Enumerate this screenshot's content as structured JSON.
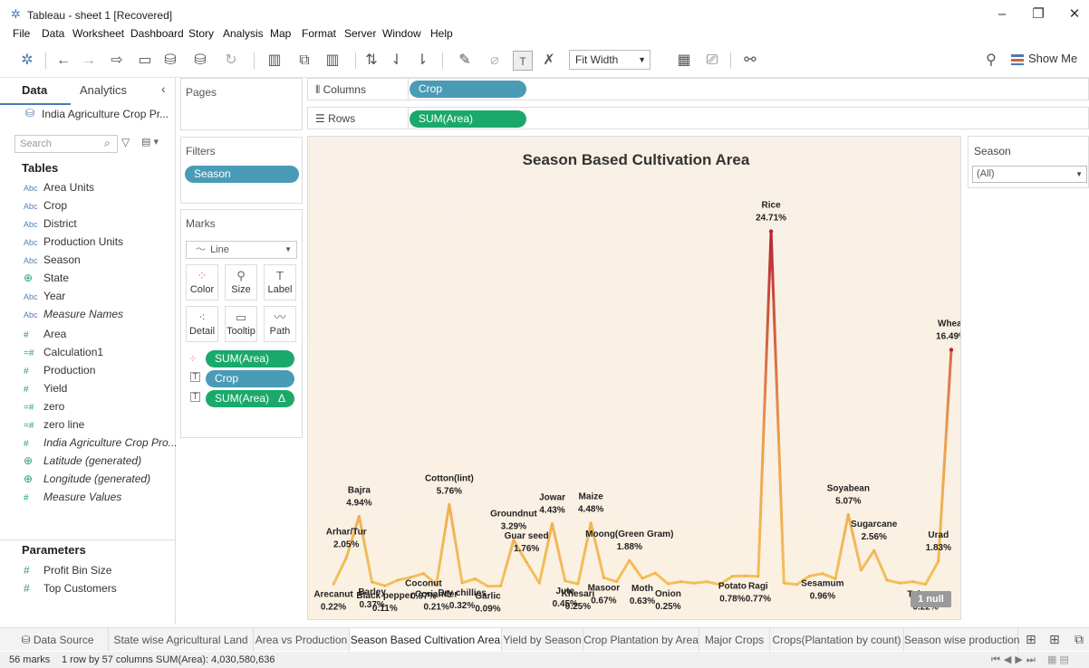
{
  "window": {
    "title": "Tableau - sheet 1 [Recovered]"
  },
  "menu": [
    "File",
    "Data",
    "Worksheet",
    "Dashboard",
    "Story",
    "Analysis",
    "Map",
    "Format",
    "Server",
    "Window",
    "Help"
  ],
  "toolbar": {
    "fit": "Fit Width",
    "show_me": "Show Me"
  },
  "data_pane": {
    "tab_data": "Data",
    "tab_analytics": "Analytics",
    "datasource": "India Agriculture Crop Pr...",
    "search_placeholder": "Search",
    "tables_header": "Tables",
    "fields": [
      {
        "type": "Abc",
        "name": "Area Units",
        "italic": false
      },
      {
        "type": "Abc",
        "name": "Crop",
        "italic": false
      },
      {
        "type": "Abc",
        "name": "District",
        "italic": false
      },
      {
        "type": "Abc",
        "name": "Production Units",
        "italic": false
      },
      {
        "type": "Abc",
        "name": "Season",
        "italic": false
      },
      {
        "type": "geo",
        "name": "State",
        "italic": false
      },
      {
        "type": "Abc",
        "name": "Year",
        "italic": false
      },
      {
        "type": "Abc",
        "name": "Measure Names",
        "italic": true
      },
      {
        "type": "#",
        "name": "Area",
        "italic": false
      },
      {
        "type": "=#",
        "name": "Calculation1",
        "italic": false
      },
      {
        "type": "#",
        "name": "Production",
        "italic": false
      },
      {
        "type": "#",
        "name": "Yield",
        "italic": false
      },
      {
        "type": "=#",
        "name": "zero",
        "italic": false
      },
      {
        "type": "=#",
        "name": "zero line",
        "italic": false
      },
      {
        "type": "#",
        "name": "India Agriculture Crop Pro...",
        "italic": true
      },
      {
        "type": "geo",
        "name": "Latitude (generated)",
        "italic": true
      },
      {
        "type": "geo",
        "name": "Longitude (generated)",
        "italic": true
      },
      {
        "type": "#",
        "name": "Measure Values",
        "italic": true
      }
    ],
    "parameters_header": "Parameters",
    "parameters": [
      "Profit Bin Size",
      "Top Customers"
    ]
  },
  "cards": {
    "pages": "Pages",
    "filters": "Filters",
    "filter_pill": "Season",
    "marks": "Marks",
    "mark_type": "Line",
    "mark_buttons": [
      "Color",
      "Size",
      "Label",
      "Detail",
      "Tooltip",
      "Path"
    ],
    "mark_pills": [
      "SUM(Area)",
      "Crop",
      "SUM(Area)"
    ],
    "delta": "Δ"
  },
  "shelves": {
    "columns_label": "Columns",
    "columns_pill": "Crop",
    "rows_label": "Rows",
    "rows_pill": "SUM(Area)"
  },
  "season_filter": {
    "label": "Season",
    "value": "(All)"
  },
  "null_indicator": "1 null",
  "tabs": [
    "Data Source",
    "State wise Agricultural Land",
    "Area vs Production",
    "Season Based Cultivation Area",
    "Yield by Season",
    "Crop Plantation by Area",
    "Major Crops",
    "Crops(Plantation by count)",
    "Season wise production"
  ],
  "active_tab": "Season Based Cultivation Area",
  "status": {
    "marks": "56 marks",
    "rows": "1 row by 57 columns",
    "sum": "SUM(Area): 4,030,580,636"
  },
  "colors": {
    "low": "#f3c25a",
    "high": "#b82232",
    "pill_blue": "#4a9bb5",
    "pill_green": "#1aa96b"
  },
  "chart_data": {
    "type": "line",
    "title": "Season Based Cultivation Area",
    "ylim": [
      0,
      25
    ],
    "grid": false,
    "legend": "none",
    "labels": [
      {
        "name": "Arecanut",
        "pct": "0.22%",
        "value": 0.22,
        "i": 0
      },
      {
        "name": "Arhar/Tur",
        "pct": "2.05%",
        "value": 2.05,
        "i": 1
      },
      {
        "name": "Bajra",
        "pct": "4.94%",
        "value": 4.94,
        "i": 2
      },
      {
        "name": "Barley",
        "pct": "0.37%",
        "value": 0.37,
        "i": 3
      },
      {
        "name": "Black pepper",
        "pct": "0.11%",
        "value": 0.11,
        "i": 4
      },
      {
        "name": "Coconut",
        "pct": "0.97%",
        "value": 0.97,
        "i": 7
      },
      {
        "name": "Coriander",
        "pct": "0.21%",
        "value": 0.21,
        "i": 8
      },
      {
        "name": "Cotton(lint)",
        "pct": "5.76%",
        "value": 5.76,
        "i": 9
      },
      {
        "name": "Dry chillies",
        "pct": "0.32%",
        "value": 0.32,
        "i": 10
      },
      {
        "name": "Garlic",
        "pct": "0.09%",
        "value": 0.09,
        "i": 12
      },
      {
        "name": "Groundnut",
        "pct": "3.29%",
        "value": 3.29,
        "i": 14
      },
      {
        "name": "Guar seed",
        "pct": "1.76%",
        "value": 1.76,
        "i": 15
      },
      {
        "name": "Jowar",
        "pct": "4.43%",
        "value": 4.43,
        "i": 17
      },
      {
        "name": "Jute",
        "pct": "0.45%",
        "value": 0.45,
        "i": 18
      },
      {
        "name": "Khesari",
        "pct": "0.25%",
        "value": 0.25,
        "i": 19
      },
      {
        "name": "Maize",
        "pct": "4.48%",
        "value": 4.48,
        "i": 20
      },
      {
        "name": "Masoor",
        "pct": "0.67%",
        "value": 0.67,
        "i": 21
      },
      {
        "name": "Moong(Green Gram)",
        "pct": "1.88%",
        "value": 1.88,
        "i": 23
      },
      {
        "name": "Moth",
        "pct": "0.63%",
        "value": 0.63,
        "i": 24
      },
      {
        "name": "Onion",
        "pct": "0.25%",
        "value": 0.25,
        "i": 26
      },
      {
        "name": "Potato",
        "pct": "0.78%",
        "value": 0.78,
        "i": 31
      },
      {
        "name": "Ragi",
        "pct": "0.77%",
        "value": 0.77,
        "i": 33
      },
      {
        "name": "Rice",
        "pct": "24.71%",
        "value": 24.71,
        "i": 34
      },
      {
        "name": "Sesamum",
        "pct": "0.96%",
        "value": 0.96,
        "i": 38
      },
      {
        "name": "Soyabean",
        "pct": "5.07%",
        "value": 5.07,
        "i": 40
      },
      {
        "name": "Sugarcane",
        "pct": "2.56%",
        "value": 2.56,
        "i": 42
      },
      {
        "name": "Tobacco",
        "pct": "0.22%",
        "value": 0.22,
        "i": 46
      },
      {
        "name": "Urad",
        "pct": "1.83%",
        "value": 1.83,
        "i": 47
      },
      {
        "name": "Wheat",
        "pct": "16.49%",
        "value": 16.49,
        "i": 48
      }
    ],
    "values": [
      0.22,
      2.05,
      4.94,
      0.37,
      0.11,
      0.5,
      0.7,
      0.97,
      0.21,
      5.76,
      0.32,
      0.6,
      0.09,
      0.1,
      3.29,
      1.76,
      0.3,
      4.43,
      0.45,
      0.25,
      4.48,
      0.67,
      0.4,
      1.88,
      0.63,
      1.0,
      0.25,
      0.4,
      0.3,
      0.4,
      0.2,
      0.78,
      0.8,
      0.77,
      24.71,
      0.3,
      0.2,
      0.8,
      0.96,
      0.6,
      5.07,
      1.2,
      2.56,
      0.5,
      0.3,
      0.4,
      0.22,
      1.83,
      16.49
    ]
  }
}
